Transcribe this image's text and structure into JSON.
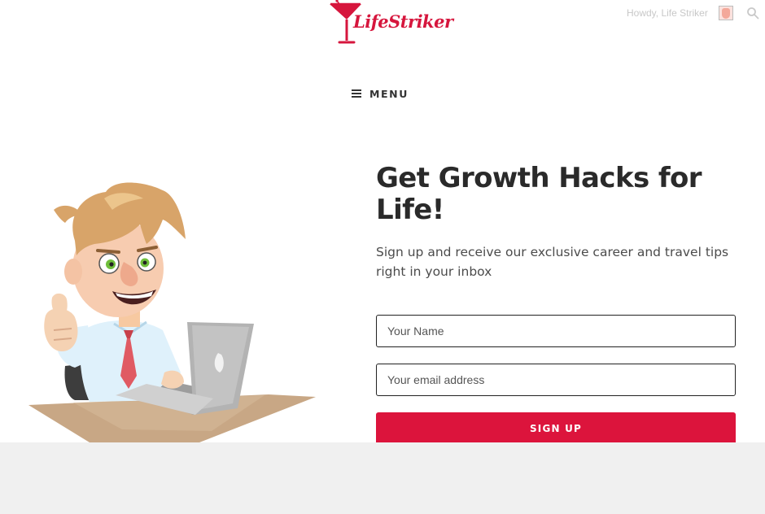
{
  "header": {
    "logo_text": "LifeStriker",
    "greeting": "Howdy, Life Striker",
    "menu_label": "MENU",
    "icons": [
      "cocktail-glass-icon",
      "avatar",
      "search-icon",
      "hamburger-icon"
    ]
  },
  "hero": {
    "headline": "Get Growth Hacks for Life!",
    "subtext": "Sign up and receive our exclusive career and travel tips right in your inbox",
    "form": {
      "name_placeholder": "Your Name",
      "email_placeholder": "Your email address",
      "submit_label": "SIGN UP"
    }
  },
  "colors": {
    "brand": "#dc143c",
    "footer_band": "#f0f0f0",
    "text": "#2a2a2a"
  }
}
